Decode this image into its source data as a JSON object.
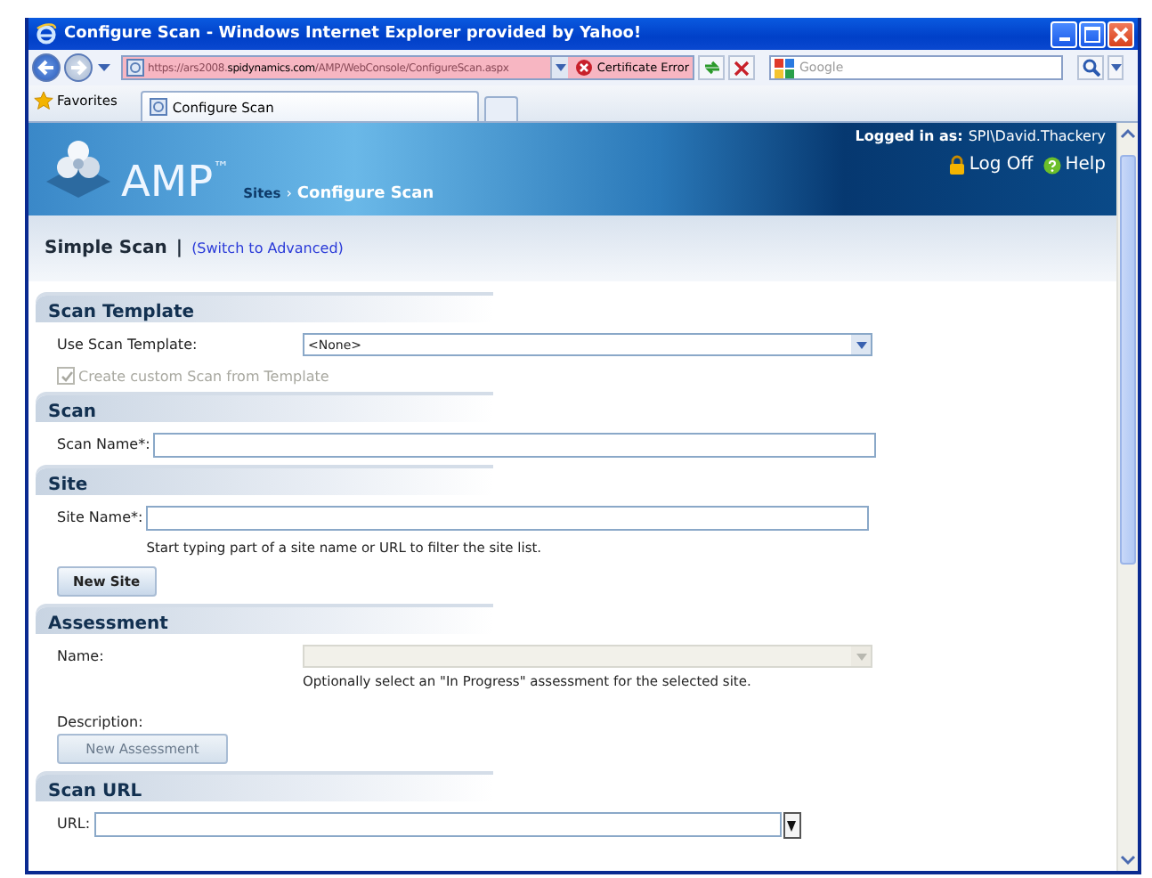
{
  "window": {
    "title": "Configure Scan - Windows Internet Explorer provided by Yahoo!"
  },
  "address_bar": {
    "url_parts": [
      {
        "text": "https://ars2008.",
        "kind": "dim"
      },
      {
        "text": "spidynamics.com",
        "kind": "host"
      },
      {
        "text": "/AMP/WebConsole/ConfigureScan.aspx",
        "kind": "dim"
      }
    ],
    "certificate_error": "Certificate Error"
  },
  "search": {
    "placeholder": "Google"
  },
  "favorites": {
    "label": "Favorites"
  },
  "tabs": [
    {
      "label": "Configure Scan",
      "selected": true
    }
  ],
  "header": {
    "logo": "AMP$^{™}$",
    "breadcrumb": [
      {
        "label": "Sites",
        "current": false
      },
      {
        "label": "Configure Scan",
        "current": true
      }
    ],
    "separator": "›",
    "logged_in_label": "Logged in as:",
    "user": "SPI\\David.Thackery",
    "links": [
      {
        "label": "Log Off",
        "kind": "lock"
      },
      {
        "label": "Help",
        "kind": "help"
      }
    ]
  },
  "mode": {
    "title": "Simple Scan",
    "separator": "|",
    "switch_link": "(Switch to Advanced)"
  },
  "sections": [
    {
      "title": "Scan Template",
      "rows": [
        {
          "kind": "select",
          "label": "Use Scan Template:",
          "value": "<None>",
          "disabled": false
        },
        {
          "kind": "checkbox",
          "label": "Create custom Scan from Template",
          "checked": true,
          "disabled": true
        }
      ]
    },
    {
      "title": "Scan",
      "rows": [
        {
          "kind": "text",
          "label": "Scan Name*:"
        }
      ]
    },
    {
      "title": "Site",
      "rows": [
        {
          "kind": "text",
          "label": "Site Name*:",
          "hint": "Start typing part of a site name or URL to filter the site list."
        },
        {
          "kind": "button",
          "label": "New Site",
          "disabled": false
        }
      ]
    },
    {
      "title": "Assessment",
      "rows": [
        {
          "kind": "select",
          "label": "Name:",
          "disabled": true,
          "hint": "Optionally select an \"In Progress\" assessment for the selected site."
        },
        {
          "kind": "label",
          "label": "Description:"
        },
        {
          "kind": "button",
          "label": "New Assessment",
          "disabled": true
        }
      ]
    },
    {
      "title": "Scan URL",
      "rows": [
        {
          "kind": "combo",
          "label": "URL:"
        }
      ]
    }
  ]
}
